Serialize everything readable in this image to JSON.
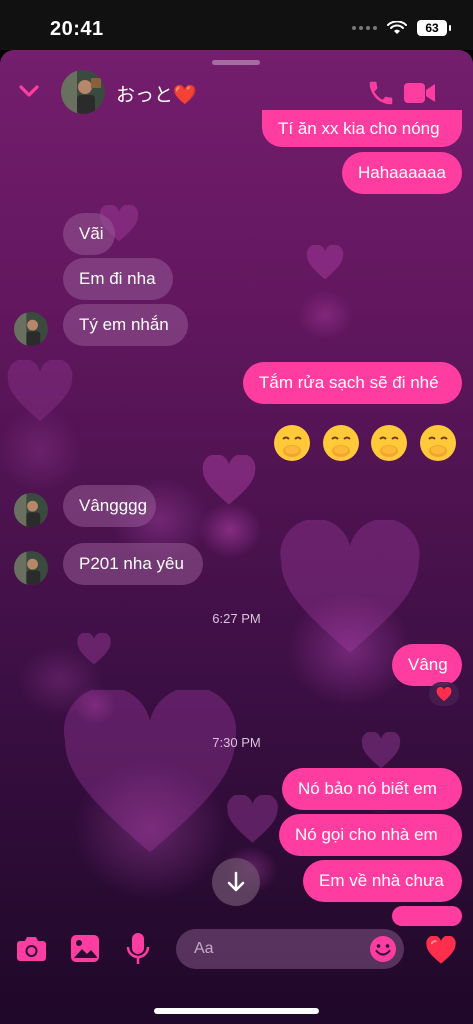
{
  "status_bar": {
    "time": "20:41",
    "battery": "63"
  },
  "header": {
    "name": "おっと❤️"
  },
  "messages": {
    "m1": "Tí ăn xx kia cho nóng",
    "m2": "Hahaaaaaa",
    "m3": "Vãi",
    "m4": "Em đi nha",
    "m5": "Tý em nhắn",
    "m6": "Tắm rửa sạch sẽ đi nhé",
    "m7": "Vângggg",
    "m8": "P201 nha yêu",
    "m9": "Vâng",
    "m10": "Nó bảo nó biết em",
    "m11": "Nó gọi cho nhà em",
    "m12": "Em về nhà chưa"
  },
  "timestamps": {
    "t1": "6:27 PM",
    "t2": "7:30 PM"
  },
  "composer": {
    "placeholder": "Aa"
  },
  "colors": {
    "accent": "#ff3da1"
  }
}
